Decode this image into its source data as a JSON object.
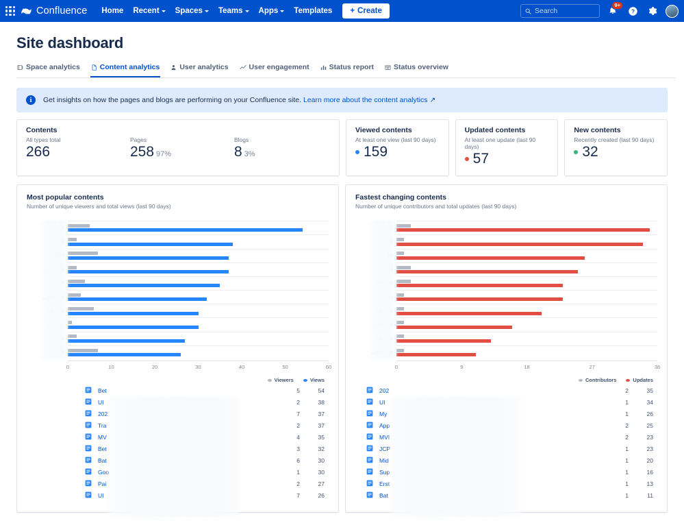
{
  "topnav": {
    "brand": "Confluence",
    "items": [
      {
        "label": "Home",
        "caret": false
      },
      {
        "label": "Recent",
        "caret": true
      },
      {
        "label": "Spaces",
        "caret": true
      },
      {
        "label": "Teams",
        "caret": true
      },
      {
        "label": "Apps",
        "caret": true
      },
      {
        "label": "Templates",
        "caret": false
      }
    ],
    "create_label": "Create",
    "search_placeholder": "Search",
    "notification_badge": "9+",
    "icons": [
      "app-switcher-icon",
      "notifications-icon",
      "help-icon",
      "settings-icon",
      "avatar"
    ],
    "brand_color": "#0052cc"
  },
  "page": {
    "title": "Site dashboard",
    "tabs": [
      {
        "label": "Space analytics",
        "icon": "space-analytics-icon",
        "active": false
      },
      {
        "label": "Content analytics",
        "icon": "content-analytics-icon",
        "active": true
      },
      {
        "label": "User analytics",
        "icon": "user-analytics-icon",
        "active": false
      },
      {
        "label": "User engagement",
        "icon": "user-engagement-icon",
        "active": false
      },
      {
        "label": "Status report",
        "icon": "status-report-icon",
        "active": false
      },
      {
        "label": "Status overview",
        "icon": "status-overview-icon",
        "active": false
      }
    ],
    "banner": {
      "text": "Get insights on how the pages and blogs are performing on your Confluence site.",
      "link": "Learn more about the content analytics",
      "link_suffix": "↗"
    }
  },
  "stats": {
    "contents": {
      "title": "Contents",
      "metrics": [
        {
          "label": "All types total",
          "value": "266",
          "pct": ""
        },
        {
          "label": "Pages",
          "value": "258",
          "pct": "97%"
        },
        {
          "label": "Blogs",
          "value": "8",
          "pct": "3%"
        }
      ]
    },
    "cards": [
      {
        "title": "Viewed contents",
        "sub": "At least one view (last 90 days)",
        "value": "159",
        "color": "#2684ff"
      },
      {
        "title": "Updated contents",
        "sub": "At least one update (last 90 days)",
        "value": "57",
        "color": "#e04e44"
      },
      {
        "title": "New contents",
        "sub": "Recently created (last 90 days)",
        "value": "32",
        "color": "#36b37e"
      }
    ]
  },
  "panels": {
    "popular": {
      "title": "Most popular contents",
      "subtitle": "Number of unique viewers and total views (last 90 days)",
      "legend": [
        {
          "label": "Viewers",
          "color": "#b3bac5"
        },
        {
          "label": "Views",
          "color": "#2684ff"
        }
      ],
      "rows": [
        {
          "name": "Bet",
          "viewers": "5",
          "views": "54"
        },
        {
          "name": "UI",
          "viewers": "2",
          "views": "38"
        },
        {
          "name": "202",
          "viewers": "7",
          "views": "37"
        },
        {
          "name": "Tra",
          "viewers": "2",
          "views": "37"
        },
        {
          "name": "MV",
          "viewers": "4",
          "views": "35"
        },
        {
          "name": "Bet",
          "viewers": "3",
          "views": "32"
        },
        {
          "name": "Bat",
          "viewers": "6",
          "views": "30"
        },
        {
          "name": "Goo",
          "viewers": "1",
          "views": "30"
        },
        {
          "name": "Pai",
          "viewers": "2",
          "views": "27"
        },
        {
          "name": "UI",
          "viewers": "7",
          "views": "26"
        }
      ]
    },
    "fastest": {
      "title": "Fastest changing contents",
      "subtitle": "Number of unique contributors and total updates (last 90 days)",
      "legend": [
        {
          "label": "Contributors",
          "color": "#b3bac5"
        },
        {
          "label": "Updates",
          "color": "#e04e44"
        }
      ],
      "rows": [
        {
          "name": "202",
          "contributors": "2",
          "updates": "35"
        },
        {
          "name": "UI",
          "contributors": "1",
          "updates": "34"
        },
        {
          "name": "My",
          "contributors": "1",
          "updates": "26"
        },
        {
          "name": "App",
          "contributors": "2",
          "updates": "25"
        },
        {
          "name": "MVI",
          "contributors": "2",
          "updates": "23"
        },
        {
          "name": "JCP",
          "contributors": "1",
          "updates": "23"
        },
        {
          "name": "Mid",
          "contributors": "1",
          "updates": "20"
        },
        {
          "name": "Sup",
          "contributors": "1",
          "updates": "16"
        },
        {
          "name": "Erst",
          "contributors": "1",
          "updates": "13"
        },
        {
          "name": "Bat",
          "contributors": "1",
          "updates": "11"
        }
      ]
    }
  },
  "chart_data": [
    {
      "type": "bar",
      "orientation": "horizontal",
      "title": "Most popular contents",
      "subtitle": "Number of unique viewers and total views (last 90 days)",
      "xlabel": "",
      "ylabel": "",
      "xlim": [
        0,
        60
      ],
      "xticks": [
        0,
        10,
        20,
        30,
        40,
        50,
        60
      ],
      "grid": true,
      "legend": [
        "Viewers",
        "Views"
      ],
      "legend_position": "bottom-right",
      "categories": [
        "B… t…",
        "UI",
        "20… …",
        "Tr… s…",
        "M… …",
        "Bet… t…",
        "B… a…",
        "G… L…",
        "P… t…",
        "UI"
      ],
      "series": [
        {
          "name": "Viewers",
          "color": "#b3bac5",
          "values": [
            5,
            2,
            7,
            2,
            4,
            3,
            6,
            1,
            2,
            7
          ]
        },
        {
          "name": "Views",
          "color": "#2684ff",
          "values": [
            54,
            38,
            37,
            37,
            35,
            32,
            30,
            30,
            27,
            26
          ]
        }
      ]
    },
    {
      "type": "bar",
      "orientation": "horizontal",
      "title": "Fastest changing contents",
      "subtitle": "Number of unique contributors and total updates (last 90 days)",
      "xlabel": "",
      "ylabel": "",
      "xlim": [
        0,
        36
      ],
      "xticks": [
        0,
        9,
        18,
        27,
        36
      ],
      "grid": true,
      "legend": [
        "Contributors",
        "Updates"
      ],
      "legend_position": "bottom-right",
      "categories": [
        "2… i…",
        "UI",
        "list",
        "A… i…",
        "M… o…",
        "J… n…",
        "M… a…",
        "Su… t…",
        "E… 2…",
        "Ba… g…"
      ],
      "series": [
        {
          "name": "Contributors",
          "color": "#b3bac5",
          "values": [
            2,
            1,
            1,
            2,
            2,
            1,
            1,
            1,
            1,
            1
          ]
        },
        {
          "name": "Updates",
          "color": "#e04e44",
          "values": [
            35,
            34,
            26,
            25,
            23,
            23,
            20,
            16,
            13,
            11
          ]
        }
      ]
    }
  ]
}
